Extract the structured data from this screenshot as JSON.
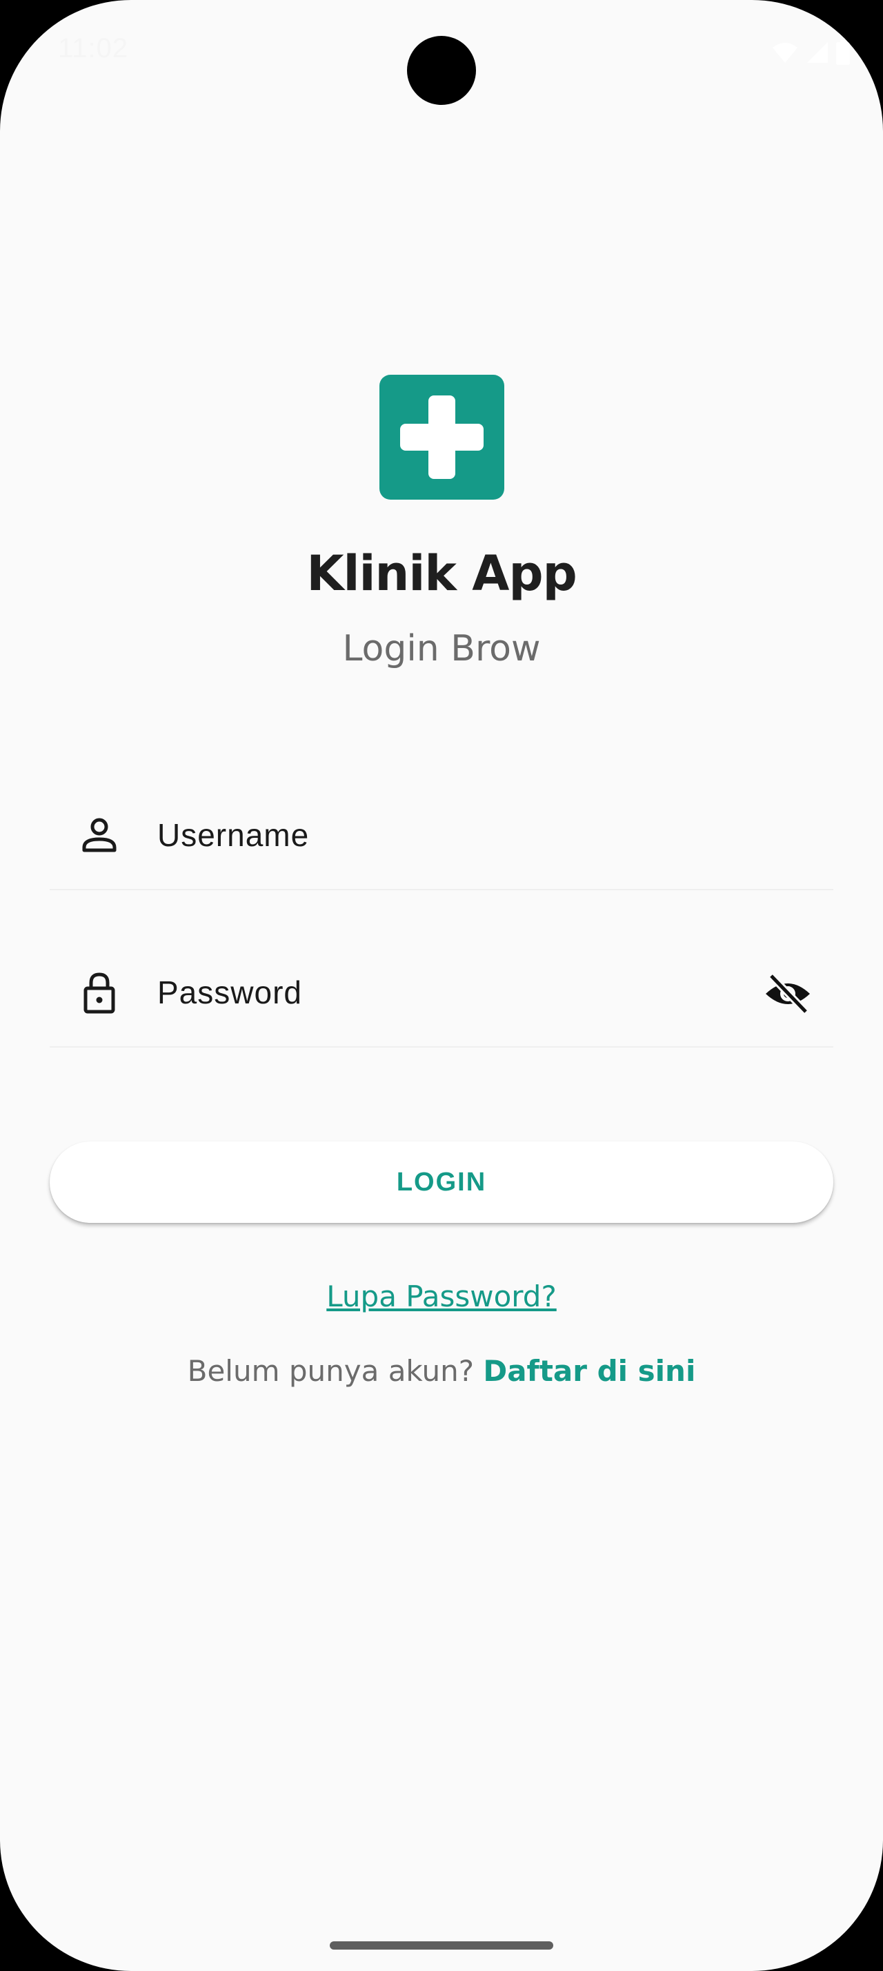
{
  "status_bar": {
    "time": "11:02"
  },
  "app": {
    "logo_icon": "medical-cross-icon",
    "title": "Klinik App",
    "subtitle": "Login Brow"
  },
  "form": {
    "username": {
      "placeholder": "Username",
      "value": "",
      "icon": "person-icon"
    },
    "password": {
      "placeholder": "Password",
      "value": "",
      "icon": "lock-icon",
      "toggle_icon": "visibility-off-icon"
    },
    "login_label": "LOGIN"
  },
  "links": {
    "forgot_password": "Lupa Password?",
    "register_prompt": "Belum punya akun?",
    "register_link": "Daftar di sini"
  },
  "colors": {
    "accent": "#159a88",
    "background": "#fafafa",
    "title_text": "#1f1f1f",
    "secondary_text": "#6b6b6b"
  }
}
